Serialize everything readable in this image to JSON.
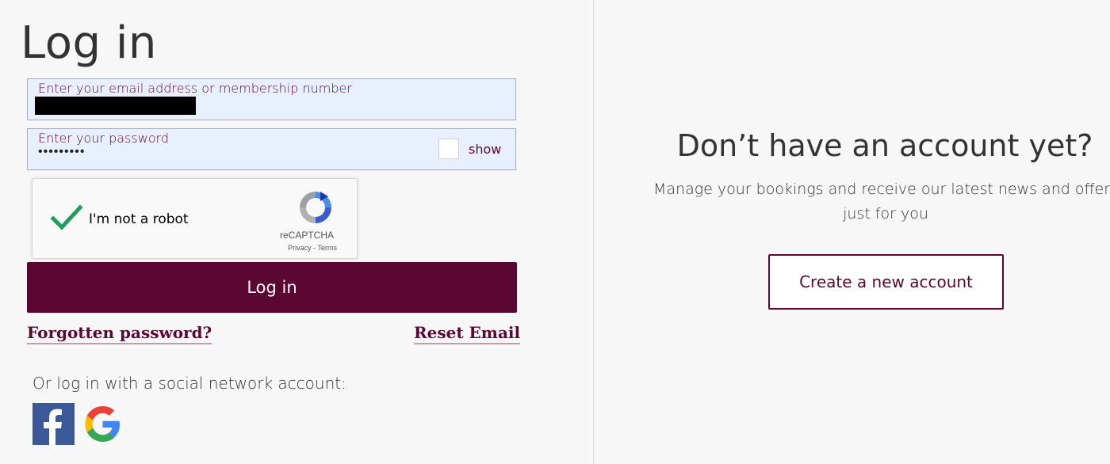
{
  "login": {
    "title": "Log in",
    "email_label": "Enter your email address or membership number",
    "password_label": "Enter your password",
    "password_mask": "•••••••••",
    "show_label": "show",
    "submit_label": "Log in",
    "forgot_link": "Forgotten password?",
    "reset_link": "Reset Email"
  },
  "recaptcha": {
    "label": "I'm not a robot",
    "brand": "reCAPTCHA",
    "privacy": "Privacy",
    "separator": " - ",
    "terms": "Terms"
  },
  "social": {
    "heading": "Or log in with a social network account:",
    "icons": [
      "facebook-icon",
      "google-icon"
    ]
  },
  "signup": {
    "heading": "Don’t have an account yet?",
    "subtext": "Manage your bookings and receive our latest news and offers just for you",
    "button_label": "Create a new account"
  },
  "colors": {
    "brand": "#5c0632",
    "field_bg": "#e8f0fe",
    "page_bg": "#f7f7f7"
  }
}
